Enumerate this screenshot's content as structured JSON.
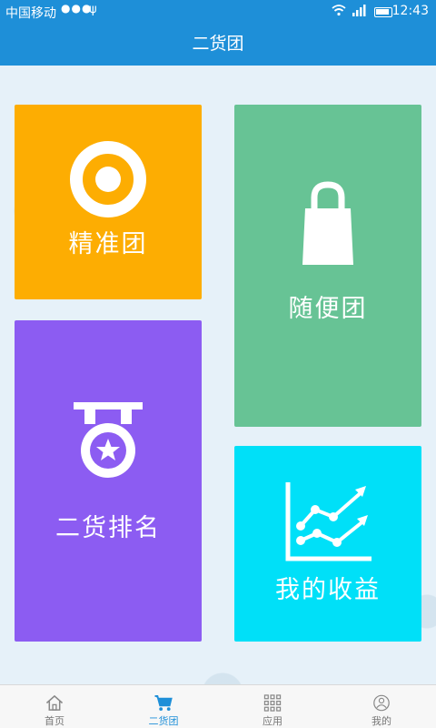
{
  "status_bar": {
    "carrier": "中国移动",
    "dots": "●●●",
    "time": "12:43"
  },
  "title": "二货团",
  "tiles": [
    {
      "label": "精准团",
      "color": "#fdad02",
      "icon": "target-icon"
    },
    {
      "label": "随便团",
      "color": "#67c395",
      "icon": "shopping-bag-icon"
    },
    {
      "label": "二货排名",
      "color": "#8c5cf2",
      "icon": "medal-icon"
    },
    {
      "label": "我的收益",
      "color": "#00e0f8",
      "icon": "trend-chart-icon"
    }
  ],
  "nav": [
    {
      "label": "首页",
      "icon": "home-icon",
      "active": false
    },
    {
      "label": "二货团",
      "icon": "cart-icon",
      "active": true
    },
    {
      "label": "应用",
      "icon": "grid-icon",
      "active": false
    },
    {
      "label": "我的",
      "icon": "user-icon",
      "active": false
    }
  ],
  "colors": {
    "accent": "#1e8fd8"
  }
}
